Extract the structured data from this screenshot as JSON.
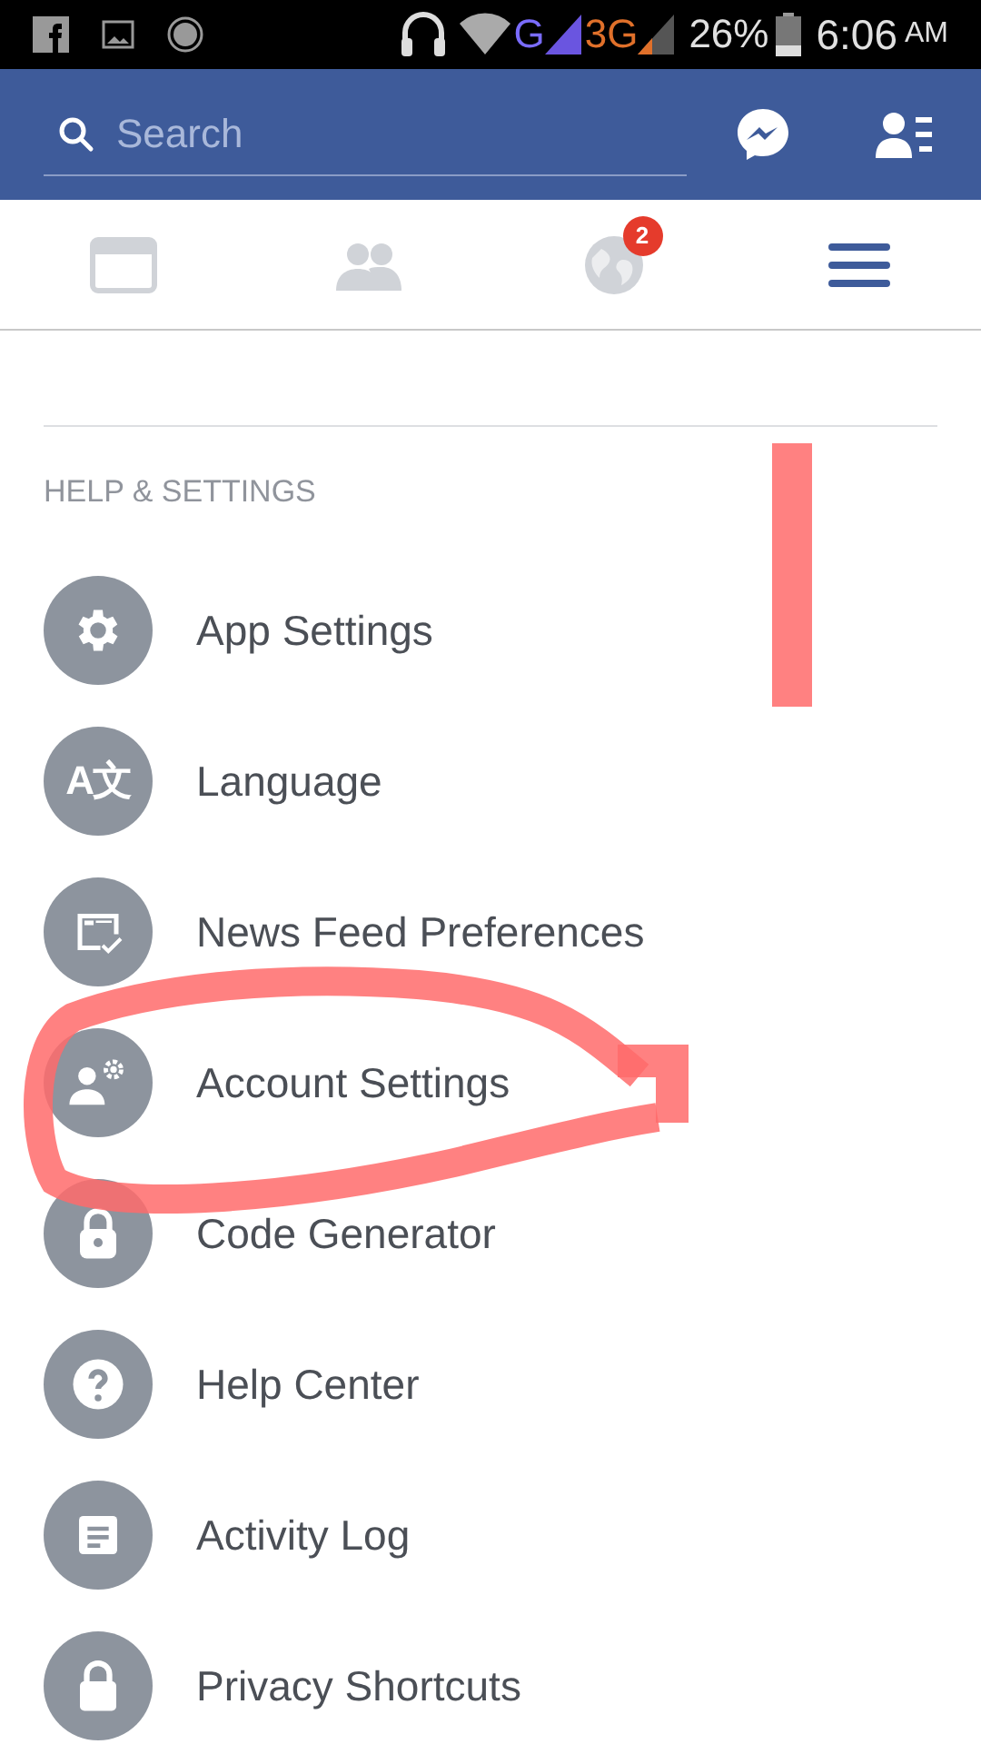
{
  "status_bar": {
    "network_g": "G",
    "network_3g": "3G",
    "battery": "26%",
    "time": "6:06",
    "ampm": "AM"
  },
  "header": {
    "search": {
      "placeholder": "Search"
    }
  },
  "tabs": [
    {
      "selected": false
    },
    {
      "selected": false
    },
    {
      "selected": false,
      "badge": "2"
    },
    {
      "selected": true
    }
  ],
  "section": {
    "title": "HELP & SETTINGS",
    "items": [
      {
        "label": "App Settings"
      },
      {
        "label": "Language",
        "glyph": "A文"
      },
      {
        "label": "News Feed Preferences"
      },
      {
        "label": "Account Settings"
      },
      {
        "label": "Code Generator"
      },
      {
        "label": "Help Center"
      },
      {
        "label": "Activity Log"
      },
      {
        "label": "Privacy Shortcuts"
      }
    ]
  }
}
